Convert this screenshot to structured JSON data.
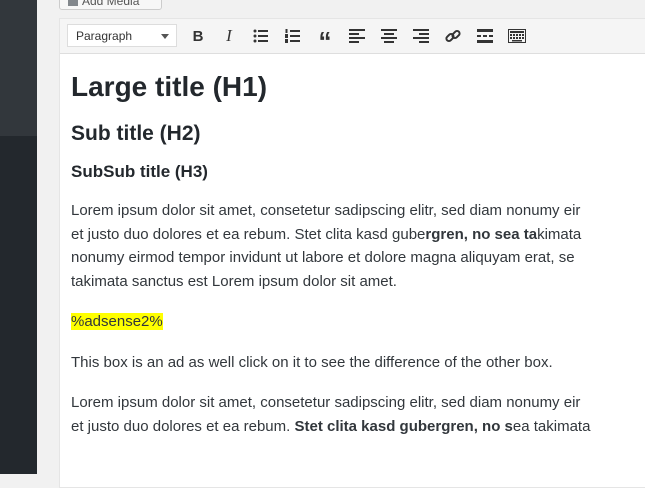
{
  "add_media": {
    "label": "Add Media"
  },
  "toolbar": {
    "format_select": "Paragraph",
    "buttons": [
      "bold",
      "italic",
      "bulleted-list",
      "numbered-list",
      "blockquote",
      "align-left",
      "align-center",
      "align-right",
      "insert-link",
      "read-more",
      "toolbar-toggle"
    ]
  },
  "content": {
    "h1": "Large title (H1)",
    "h2": "Sub title (H2)",
    "h3": "SubSub title (H3)",
    "para1": {
      "line1": "Lorem ipsum dolor sit amet, consetetur sadipscing elitr, sed diam nonumy eir",
      "line2_a": "et justo duo dolores et ea rebum. Stet clita kasd gube",
      "line2_b": "rgren, no sea ta",
      "line2_c": "kimata",
      "line3": "nonumy eirmod tempor invidunt ut labore et dolore magna aliquyam erat, se",
      "line4": "takimata sanctus est Lorem ipsum dolor sit amet."
    },
    "ad_shortcode": "%adsense2%",
    "note": "This box is an ad as well click on it to see the difference of the other box.",
    "para2": {
      "line1": "Lorem ipsum dolor sit amet, consetetur sadipscing elitr, sed diam nonumy eir",
      "line2_a": "et justo duo dolores et ea rebum. ",
      "line2_b": "Stet clita kasd gubergren, no s",
      "line2_c": "ea takimata"
    }
  },
  "colors": {
    "sidebar": "#23282d",
    "highlight": "#ffff00",
    "text": "#32373c"
  }
}
